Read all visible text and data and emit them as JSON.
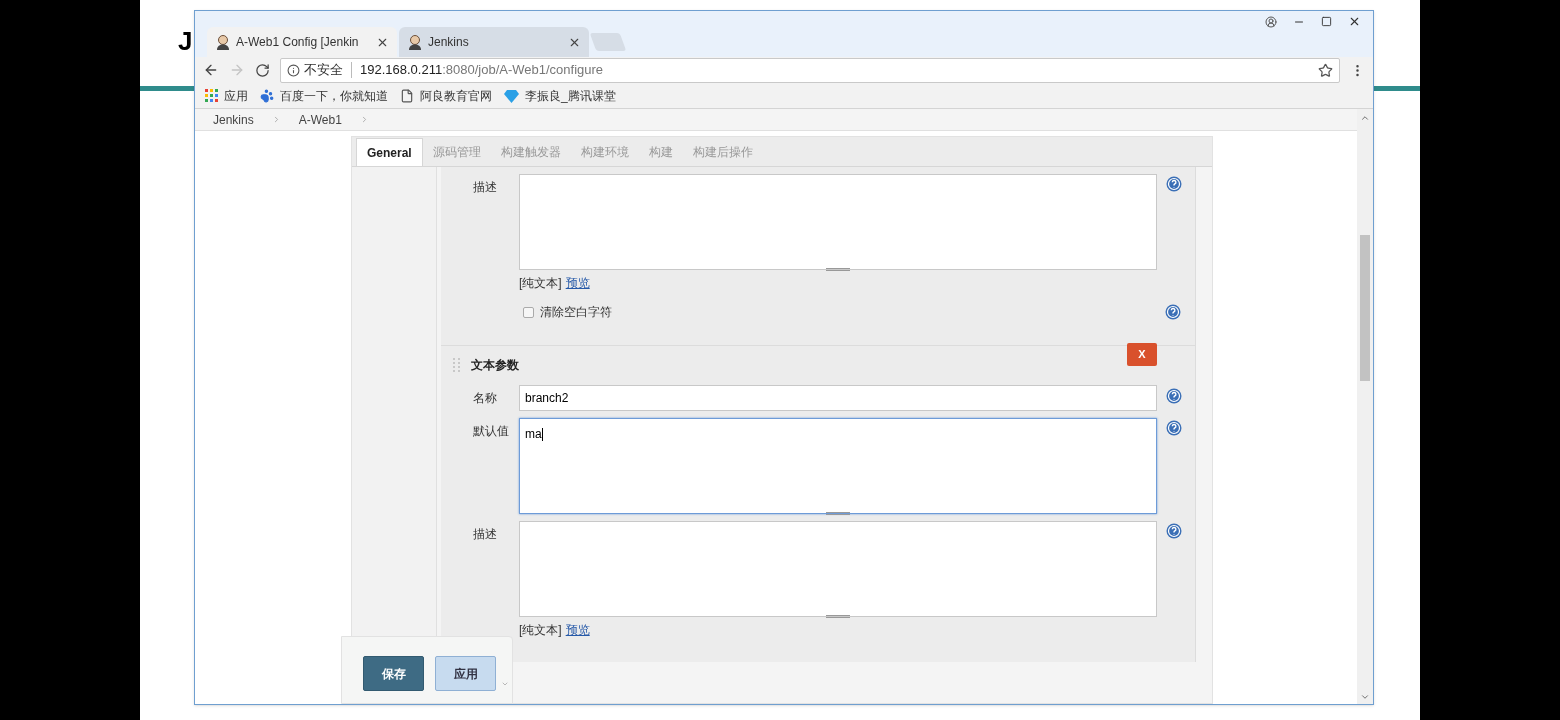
{
  "backdrop_heading": "J",
  "browser": {
    "tabs": [
      {
        "title": "A-Web1 Config [Jenkin",
        "selected": true
      },
      {
        "title": "Jenkins",
        "selected": false
      }
    ],
    "address": {
      "security": "不安全",
      "host": "192.168.0.211",
      "rest": ":8080/job/A-Web1/configure"
    },
    "bookmarks": [
      {
        "label": "应用",
        "kind": "apps"
      },
      {
        "label": "百度一下，你就知道",
        "kind": "paw"
      },
      {
        "label": "阿良教育官网",
        "kind": "page"
      },
      {
        "label": "李振良_腾讯课堂",
        "kind": "gem"
      }
    ]
  },
  "breadcrumbs": [
    "Jenkins",
    "A-Web1"
  ],
  "config_tabs": [
    {
      "label": "General",
      "selected": true
    },
    {
      "label": "源码管理",
      "selected": false
    },
    {
      "label": "构建触发器",
      "selected": false
    },
    {
      "label": "构建环境",
      "selected": false
    },
    {
      "label": "构建",
      "selected": false
    },
    {
      "label": "构建后操作",
      "selected": false
    }
  ],
  "params": [
    {
      "fields": [
        {
          "kind": "textarea",
          "label": "描述",
          "focused": false
        },
        {
          "kind": "format",
          "text": "[纯文本]",
          "link": "预览"
        },
        {
          "kind": "checkbox",
          "label": "清除空白字符",
          "checked": false
        }
      ]
    },
    {
      "title": "文本参数",
      "delete": "X",
      "fields": [
        {
          "kind": "input",
          "label": "名称",
          "value": "branch2"
        },
        {
          "kind": "textarea",
          "label": "默认值",
          "value": "ma",
          "focused": true
        },
        {
          "kind": "textarea",
          "label": "描述",
          "focused": false
        },
        {
          "kind": "format",
          "text": "[纯文本]",
          "link": "预览"
        }
      ]
    }
  ],
  "buttons": [
    {
      "label": "保存",
      "kind": "primary"
    },
    {
      "label": "应用",
      "kind": "secondary"
    }
  ]
}
